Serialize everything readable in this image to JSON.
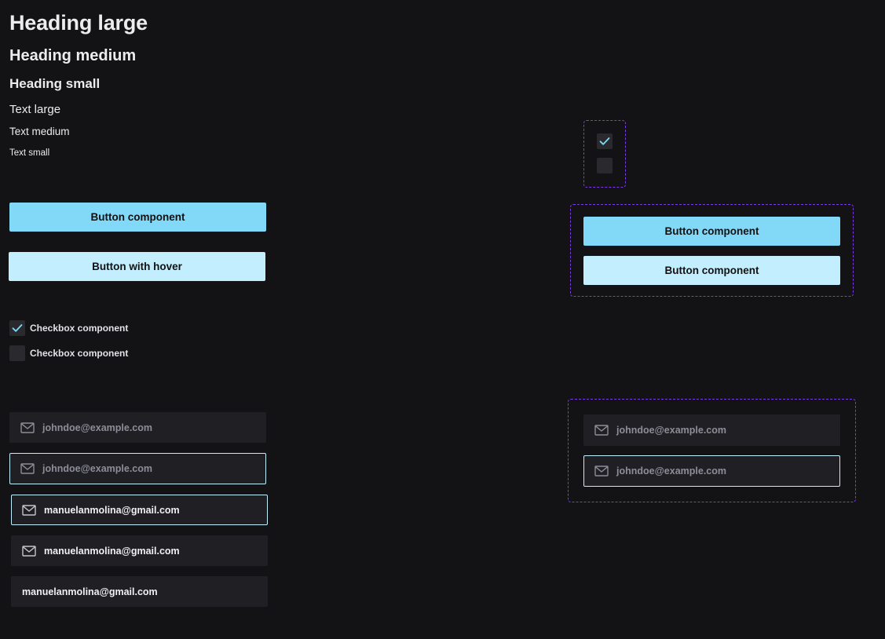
{
  "typography": {
    "heading_large": "Heading large",
    "heading_medium": "Heading medium",
    "heading_small": "Heading small",
    "text_large": "Text large",
    "text_medium": "Text medium",
    "text_small": "Text small"
  },
  "buttons": {
    "primary_label": "Button component",
    "hover_label": "Button with hover"
  },
  "checkboxes": [
    {
      "label": "Checkbox component",
      "checked": true
    },
    {
      "label": "Checkbox component",
      "checked": false
    }
  ],
  "inputs": {
    "placeholder": "johndoe@example.com",
    "filled_value": "manuelanmolina@gmail.com"
  },
  "variants": {
    "checkbox_states": [
      true,
      false
    ],
    "button_labels": [
      "Button component",
      "Button component"
    ],
    "input_placeholders": [
      "johndoe@example.com",
      "johndoe@example.com"
    ]
  },
  "colors": {
    "background": "#131315",
    "primary": "#81d8f7",
    "primary_hover": "#c2eefd",
    "input_bg": "#202024",
    "frame_dash": "#7c3aed"
  },
  "icons": {
    "mail": "mail-icon",
    "check": "check-icon"
  }
}
